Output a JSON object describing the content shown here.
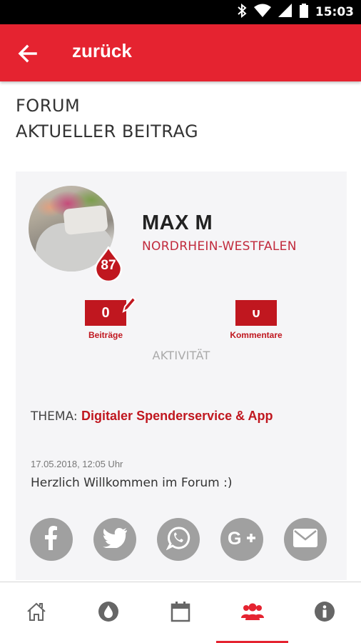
{
  "status_bar": {
    "time": "15:03",
    "icons": [
      "bluetooth-icon",
      "wifi-icon",
      "signal-icon",
      "battery-icon"
    ]
  },
  "app_bar": {
    "back_label": "zurück",
    "background_color": "#e52330"
  },
  "page": {
    "title_line1": "FORUM",
    "title_line2": "AKTUELLER BEITRAG"
  },
  "profile": {
    "name": "MAX M",
    "region": "NORDRHEIN-WESTFALEN",
    "donation_count": "87",
    "stats": {
      "posts_value": "0",
      "posts_label": "Beiträge",
      "comments_value": "0",
      "comments_label": "Kommentare"
    },
    "activity_label": "AKTIVITÄT"
  },
  "post": {
    "topic_prefix": "THEMA: ",
    "topic": "Digitaler Spenderservice & App",
    "date": "17.05.2018, 12:05 Uhr",
    "text": "Herzlich Willkommen im Forum :)"
  },
  "share_buttons": [
    "facebook-icon",
    "twitter-icon",
    "whatsapp-icon",
    "google-plus-icon",
    "mail-icon"
  ],
  "bottom_nav": {
    "items": [
      "home-icon",
      "blood-drop-icon",
      "calendar-icon",
      "community-icon",
      "info-icon"
    ],
    "active": "community-icon",
    "active_color": "#e52330",
    "inactive_color": "#666666"
  }
}
